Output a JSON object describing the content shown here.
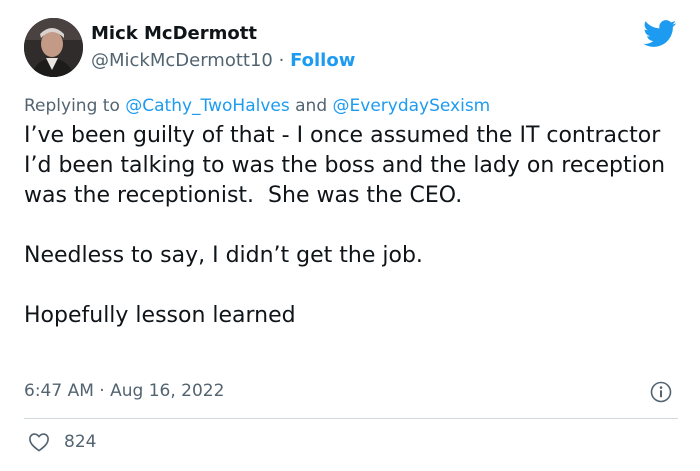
{
  "author": {
    "name": "Mick McDermott",
    "handle": "@MickMcDermott10",
    "separator": "·",
    "follow_label": "Follow"
  },
  "reply": {
    "prefix": "Replying to",
    "mention_1": "@Cathy_TwoHalves",
    "conjunction": "and",
    "mention_2": "@EverydaySexism"
  },
  "tweet": {
    "paragraphs": [
      "I’ve been guilty of that - I once assumed the IT contractor I’d been talking to was the boss and the lady on reception was the receptionist.  She was the CEO.",
      "Needless to say, I didn’t get the job.",
      "Hopefully lesson learned"
    ]
  },
  "meta": {
    "time": "6:47 AM",
    "separator": "·",
    "date": "Aug 16, 2022"
  },
  "engagement": {
    "likes": "824"
  },
  "icons": {
    "logo": "twitter-bird-icon",
    "info": "info-icon",
    "like": "heart-icon"
  },
  "colors": {
    "accent": "#1d9bf0",
    "text": "#0f1419",
    "secondary": "#536471",
    "divider": "#cfd9de"
  }
}
